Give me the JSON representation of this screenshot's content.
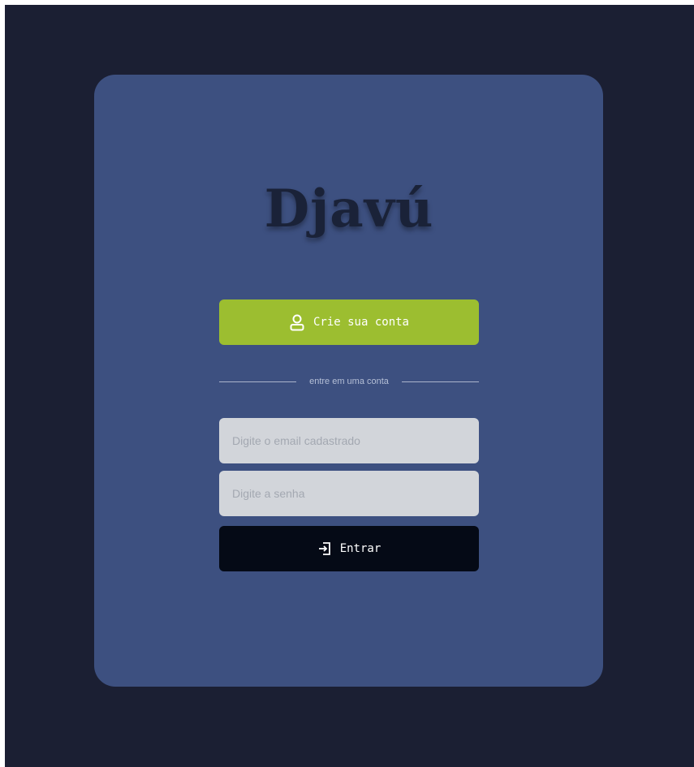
{
  "brand": {
    "logo_text": "Djavú"
  },
  "signup": {
    "button_label": "Crie sua conta",
    "icon": "user-icon"
  },
  "divider": {
    "text": "entre em uma conta"
  },
  "login": {
    "email_placeholder": "Digite o email cadastrado",
    "email_value": "",
    "password_placeholder": "Digite a senha",
    "password_value": "",
    "submit_label": "Entrar",
    "submit_icon": "login-arrow-icon"
  },
  "colors": {
    "background": "#1b1f33",
    "card": "#3d5080",
    "accent_green": "#9cbe30",
    "submit_dark": "#050a16",
    "input_bg": "#d2d5da",
    "logo": "#1a2238"
  }
}
